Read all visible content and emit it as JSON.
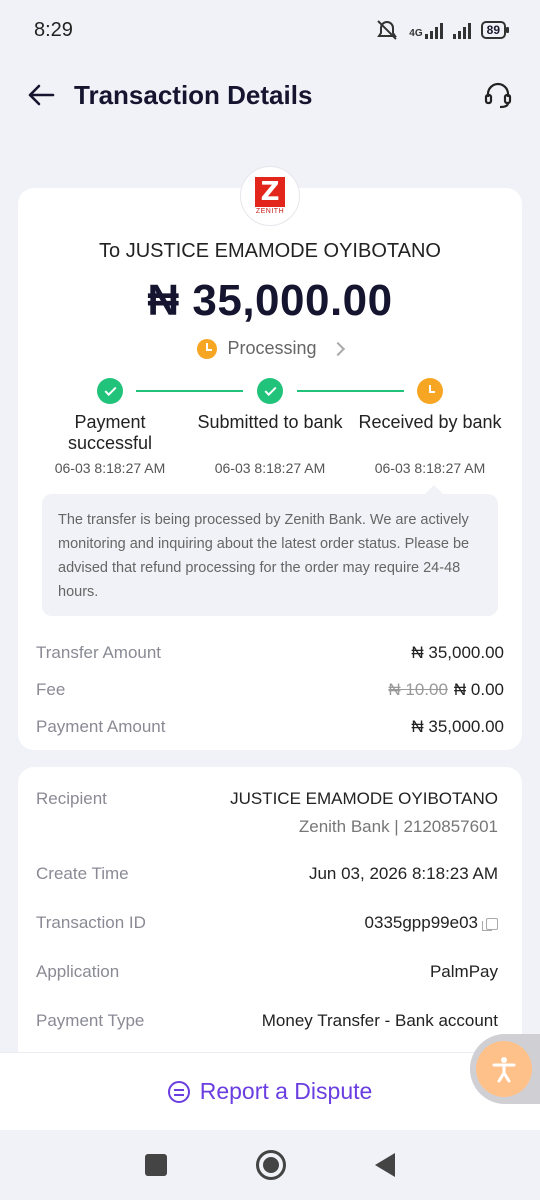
{
  "status_bar": {
    "time": "8:29",
    "network": "4G",
    "battery": "89"
  },
  "header": {
    "title": "Transaction Details"
  },
  "bank": {
    "logo_letter": "Z",
    "logo_name": "ZENITH"
  },
  "summary": {
    "recipient_line": "To JUSTICE EMAMODE OYIBOTANO",
    "amount": "₦ 35,000.00",
    "status": "Processing"
  },
  "steps": [
    {
      "label": "Payment successful",
      "time": "06-03 8:18:27 AM",
      "state": "done"
    },
    {
      "label": "Submitted to bank",
      "time": "06-03 8:18:27 AM",
      "state": "done"
    },
    {
      "label": "Received by bank",
      "time": "06-03 8:18:27 AM",
      "state": "pending"
    }
  ],
  "notice": "The transfer is being processed by Zenith Bank. We are actively monitoring and inquiring about the latest order status. Please be advised that refund processing for the order may require 24-48 hours.",
  "fees": {
    "transfer_amount_label": "Transfer Amount",
    "transfer_amount_value": "₦ 35,000.00",
    "fee_label": "Fee",
    "fee_original": "₦ 10.00",
    "fee_value": "₦ 0.00",
    "payment_amount_label": "Payment Amount",
    "payment_amount_value": "₦ 35,000.00"
  },
  "details": {
    "recipient_label": "Recipient",
    "recipient_name": "JUSTICE EMAMODE OYIBOTANO",
    "recipient_bank": "Zenith Bank | 2120857601",
    "create_time_label": "Create Time",
    "create_time_value": "Jun 03, 2026 8:18:23 AM",
    "transaction_id_label": "Transaction ID",
    "transaction_id_value": "0335gpp99e03",
    "application_label": "Application",
    "application_value": "PalmPay",
    "payment_type_label": "Payment Type",
    "payment_type_value": "Money Transfer - Bank account"
  },
  "footer": {
    "dispute_label": "Report a Dispute"
  },
  "colors": {
    "accent": "#6a3ee0",
    "success": "#21c27a",
    "pending": "#f6a623",
    "brand_red": "#e3261b"
  }
}
